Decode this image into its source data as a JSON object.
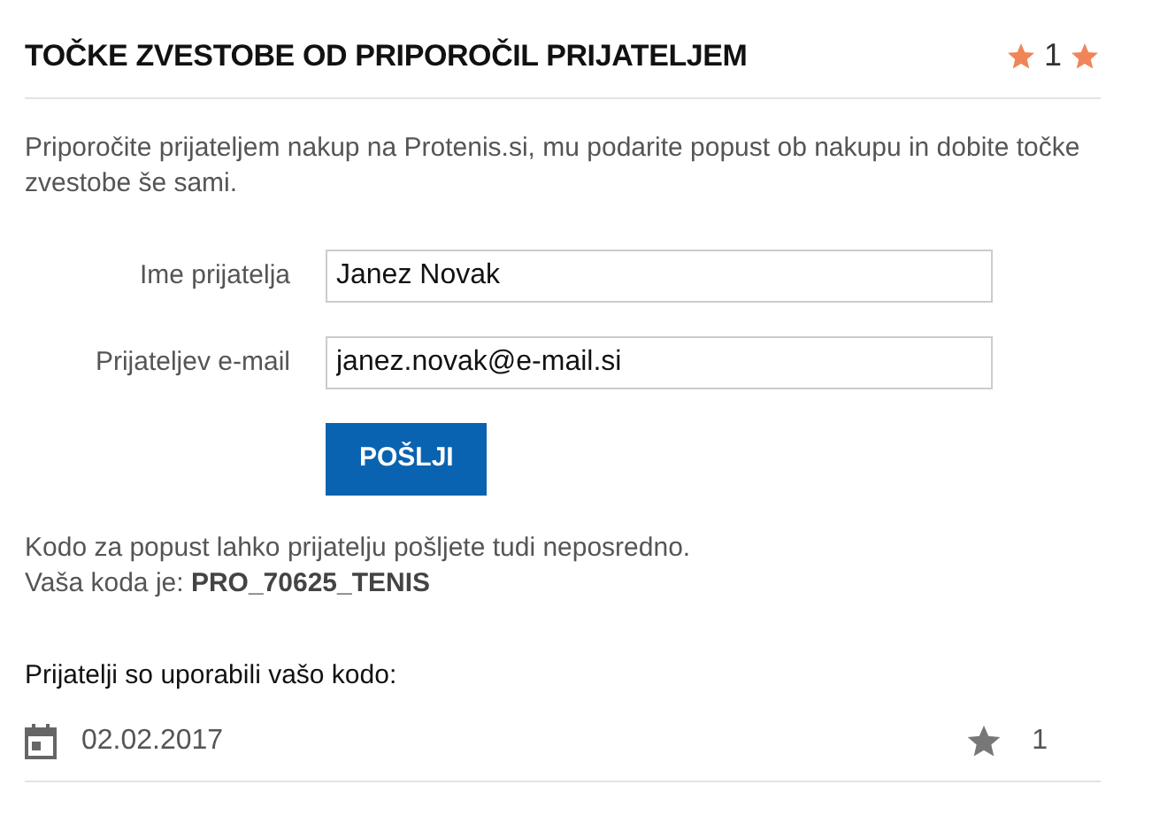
{
  "header": {
    "title": "TOČKE ZVESTOBE OD PRIPOROČIL PRIJATELJEM",
    "points": "1"
  },
  "intro": "Priporočite prijateljem nakup na Protenis.si, mu podarite popust ob nakupu in dobite točke zvestobe še sami.",
  "form": {
    "fields": [
      {
        "label": "Ime prijatelja",
        "value": "Janez Novak"
      },
      {
        "label": "Prijateljev e-mail",
        "value": "janez.novak@e-mail.si"
      }
    ],
    "submit": "POŠLJI"
  },
  "code_info": [
    "Kodo za popust lahko prijatelju pošljete tudi neposredno.",
    "Vaša koda je: **PRO_70625_TENIS**"
  ],
  "used_heading": "Prijatelji so uporabili vašo kodo:",
  "uses": [
    {
      "date": "02.02.2017",
      "points": "1"
    }
  ]
}
